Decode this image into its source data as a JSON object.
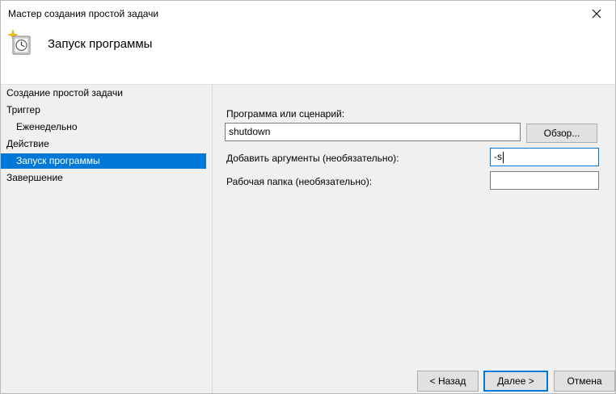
{
  "window": {
    "title": "Мастер создания простой задачи",
    "heading": "Запуск программы"
  },
  "nav": {
    "items": [
      {
        "label": "Создание простой задачи",
        "level": 0,
        "selected": false
      },
      {
        "label": "Триггер",
        "level": 0,
        "selected": false
      },
      {
        "label": "Еженедельно",
        "level": 1,
        "selected": false
      },
      {
        "label": "Действие",
        "level": 0,
        "selected": false
      },
      {
        "label": "Запуск программы",
        "level": 1,
        "selected": true
      },
      {
        "label": "Завершение",
        "level": 0,
        "selected": false
      }
    ]
  },
  "form": {
    "program_label": "Программа или сценарий:",
    "program_value": "shutdown",
    "browse_label": "Обзор...",
    "args_label": "Добавить аргументы (необязательно):",
    "args_value": "-s",
    "workdir_label": "Рабочая папка (необязательно):",
    "workdir_value": ""
  },
  "buttons": {
    "back": "< Назад",
    "next": "Далее >",
    "cancel": "Отмена"
  },
  "colors": {
    "selection": "#0078d7",
    "window_bg": "#f0f0f0",
    "header_bg": "#ffffff"
  },
  "icons": {
    "header_icon": "task-scheduler-clock-icon",
    "close": "close-icon"
  }
}
